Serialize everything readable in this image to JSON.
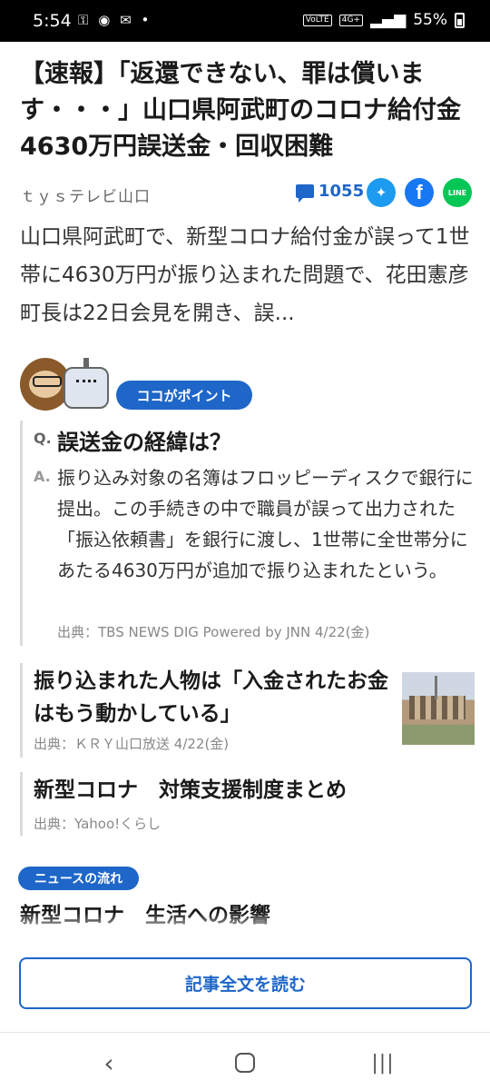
{
  "status_bar": {
    "time": "5:54",
    "notification_icons": [
      "vpn-key-icon",
      "chrome-icon",
      "mail-icon",
      "dot-icon"
    ],
    "network": "VoLTE",
    "signal": "4G+",
    "battery": "55%"
  },
  "article": {
    "headline": "【速報】「返還できない、罪は償います・・・」山口県阿武町のコロナ給付金4630万円誤送金・回収困難",
    "source": "ｔｙｓテレビ山口",
    "comment_count": "1055",
    "share_icons": [
      "twitter-icon",
      "facebook-icon",
      "line-icon"
    ],
    "line_label": "LINE",
    "lead": "山口県阿武町で、新型コロナ給付金が誤って1世帯に4630万円が振り込まれた問題で、花田憲彦町長は22日会見を開き、誤..."
  },
  "point": {
    "badge": "ココがポイント",
    "q_mark": "Q.",
    "question": "誤送金の経緯は？",
    "a_mark": "A.",
    "answer": "振り込み対象の名簿はフロッピーディスクで銀行に提出。この手続きの中で職員が誤って出力された「振込依頼書」を銀行に渡し、1世帯に全世帯分にあたる4630万円が追加で振り込まれたという。",
    "source": "出典：TBS NEWS DIG Powered by JNN 4/22(金)"
  },
  "related": [
    {
      "title": "振り込まれた人物は「入金されたお金はもう動かしている」",
      "source": "出典：ＫＲＹ山口放送 4/22(金)"
    },
    {
      "title": "新型コロナ　対策支援制度まとめ",
      "source": "出典：Yahoo!くらし"
    }
  ],
  "news_flow": {
    "badge": "ニュースの流れ",
    "title": "新型コロナ　生活への影響"
  },
  "read_more": "記事全文を読む",
  "nav": {
    "back": "‹",
    "recent": "|||"
  }
}
